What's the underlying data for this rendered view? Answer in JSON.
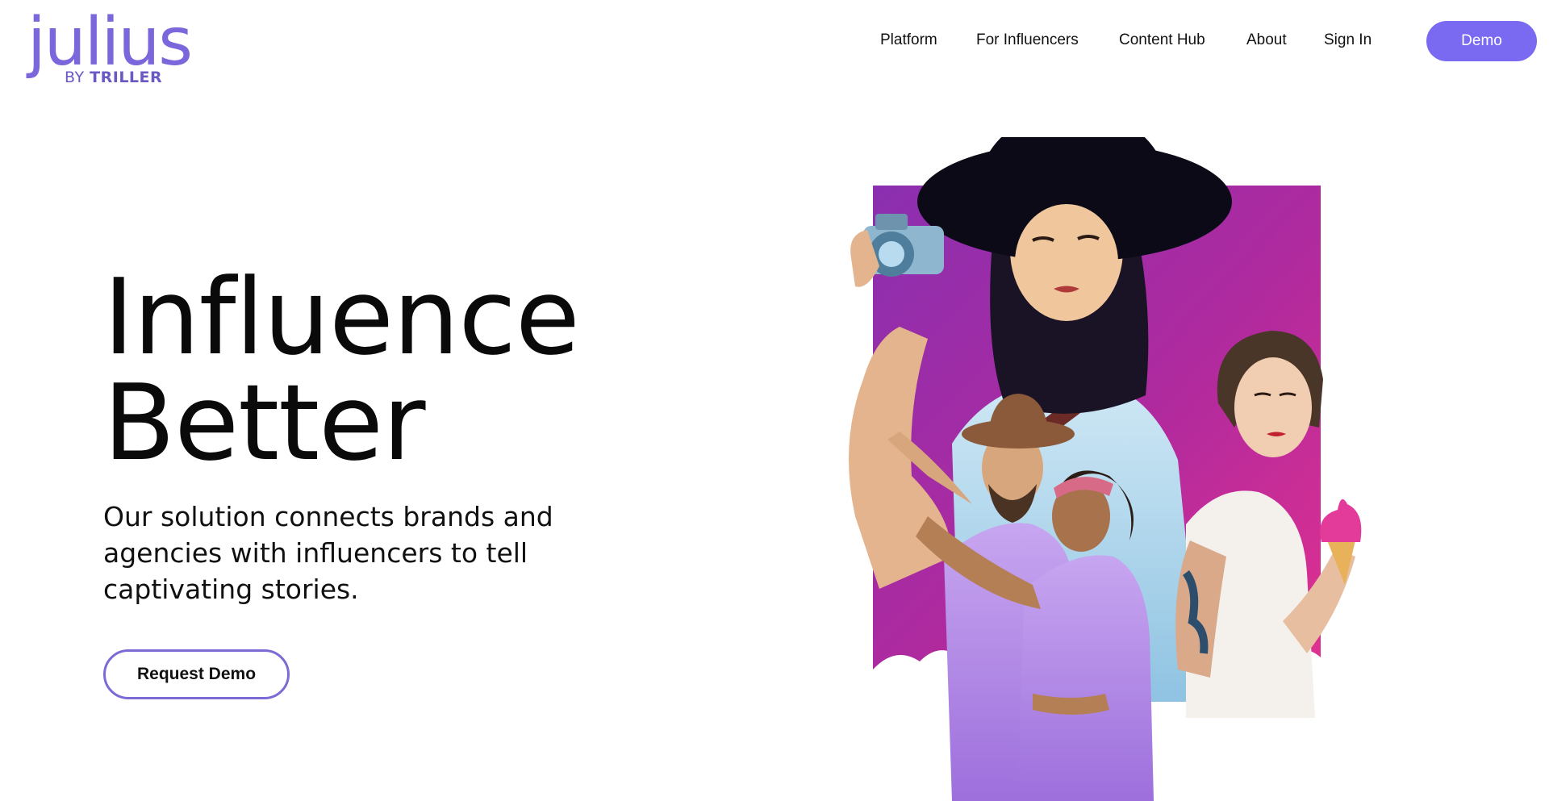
{
  "header": {
    "logo": {
      "word": "julius",
      "by": "BY",
      "brand": "TRILLER"
    },
    "nav": [
      {
        "label": "Platform"
      },
      {
        "label": "For Influencers"
      },
      {
        "label": "Content Hub"
      },
      {
        "label": "About"
      },
      {
        "label": "Sign In"
      }
    ],
    "demo_label": "Demo"
  },
  "hero": {
    "title_line1": "Influence",
    "title_line2": "Better",
    "subtitle_lines": [
      "Our solution connects brands and",
      "agencies with influencers to tell",
      "captivating stories."
    ],
    "cta_label": "Request Demo"
  },
  "colors": {
    "accent": "#7a6af1",
    "logo": "#7b66dc",
    "cta_border": "#7a6bd6",
    "backdrop_pink": "#e0308f",
    "backdrop_purple": "#7a2aa8"
  }
}
